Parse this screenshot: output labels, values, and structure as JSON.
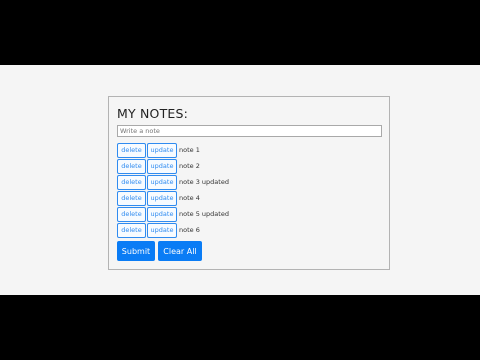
{
  "app": {
    "title": "MY NOTES:",
    "input": {
      "placeholder": "Write a note",
      "value": ""
    },
    "buttons": {
      "delete": "delete",
      "update": "update",
      "submit": "Submit",
      "clear_all": "Clear All"
    },
    "notes": [
      {
        "text": "note 1"
      },
      {
        "text": "note 2"
      },
      {
        "text": "note 3 updated"
      },
      {
        "text": "note 4"
      },
      {
        "text": "note 5 updated"
      },
      {
        "text": "note 6"
      }
    ]
  },
  "colors": {
    "primary": "#0a7cf5",
    "outline": "#2f8bf0",
    "page_background": "#f5f5f5",
    "letterbox": "#000000",
    "card_border": "#b3b3b3"
  }
}
